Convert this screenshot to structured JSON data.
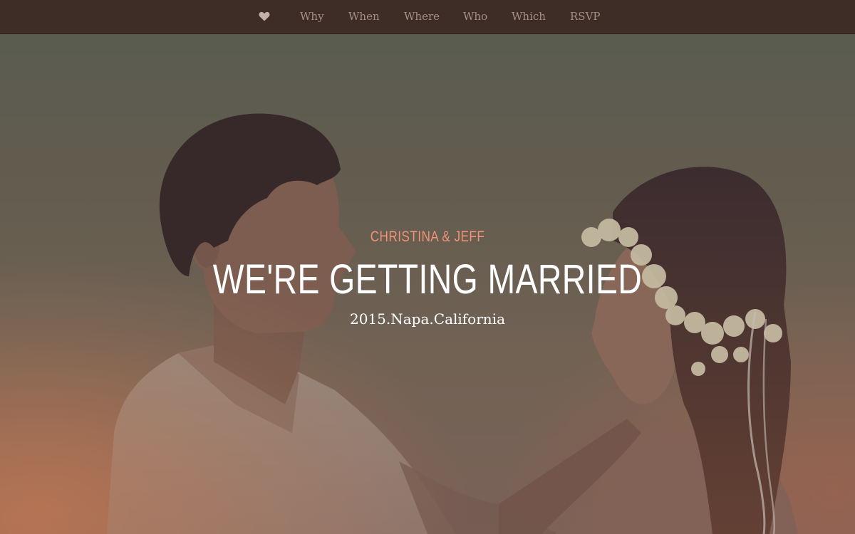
{
  "nav": {
    "home_icon": "heart-icon",
    "items": [
      {
        "label": "Why"
      },
      {
        "label": "When"
      },
      {
        "label": "Where"
      },
      {
        "label": "Who"
      },
      {
        "label": "Which"
      },
      {
        "label": "RSVP"
      }
    ]
  },
  "hero": {
    "names": "CHRISTINA & JEFF",
    "headline": "WE'RE GETTING MARRIED",
    "event": "2015.Napa.California"
  },
  "colors": {
    "nav_background": "#3e2c27",
    "nav_link": "#a48f83",
    "accent_names": "#ef9277",
    "headline": "#ffffff"
  }
}
